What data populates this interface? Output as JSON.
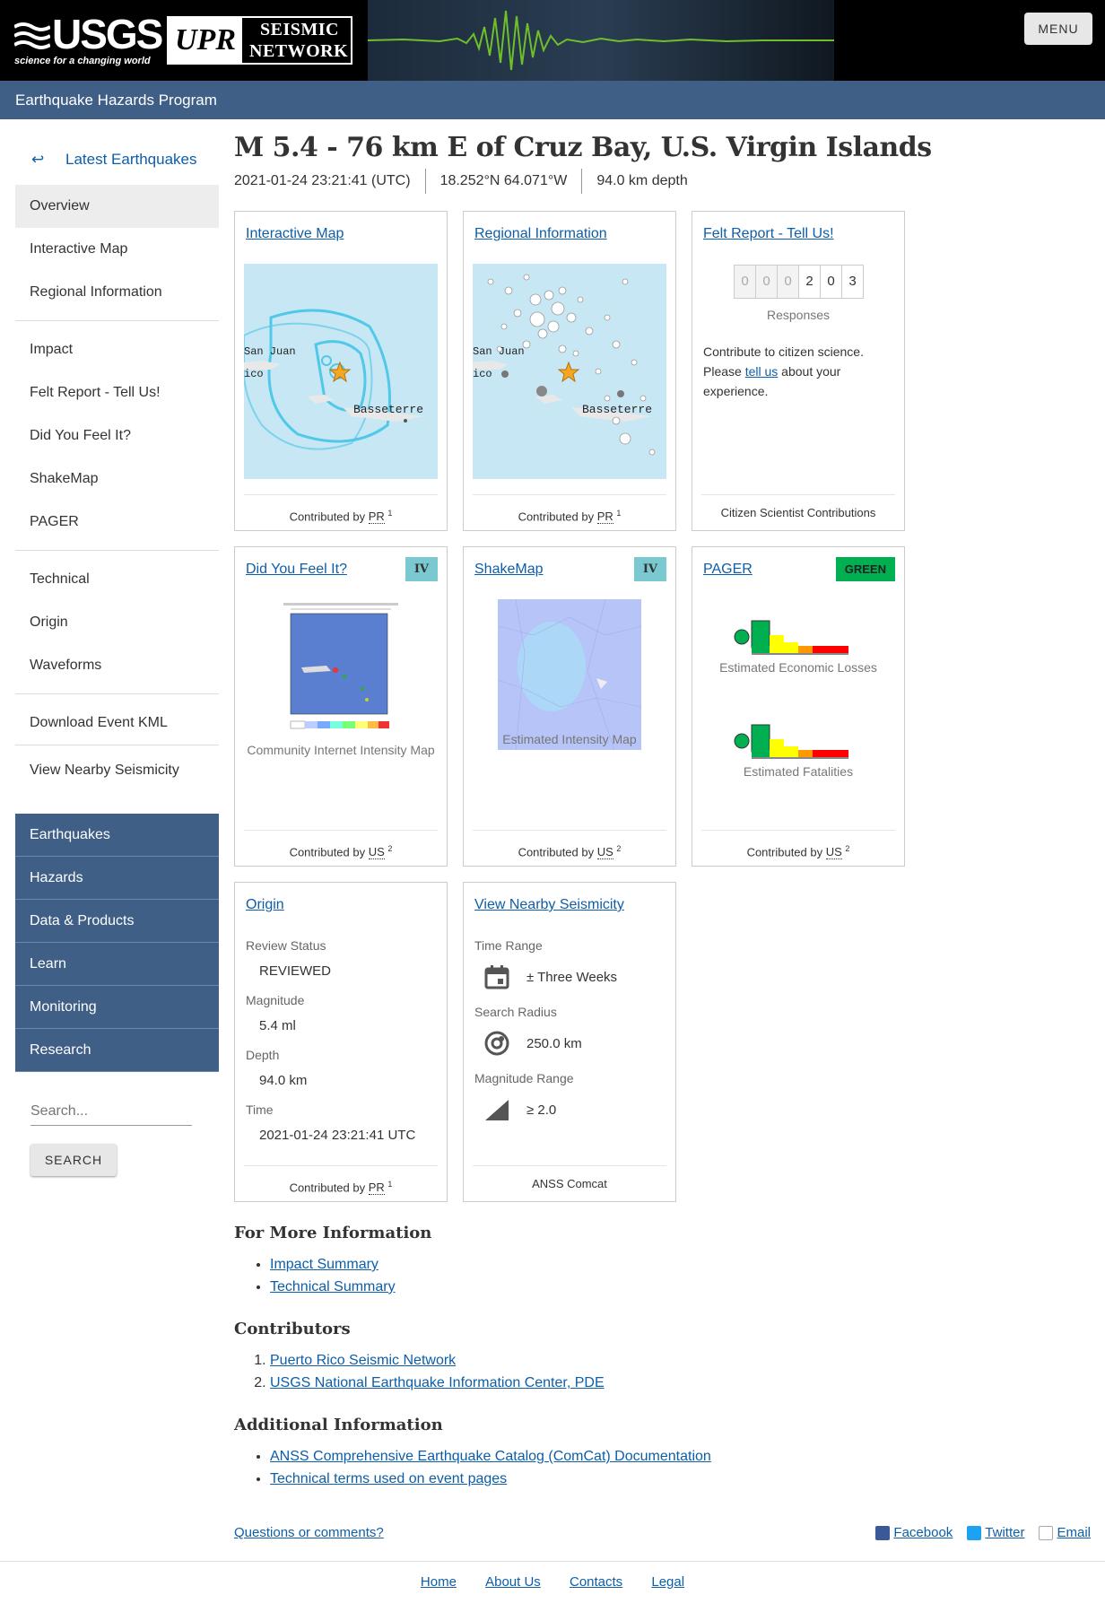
{
  "header": {
    "usgs_word": "USGS",
    "usgs_tagline": "science for a changing world",
    "upr_box": "UPR",
    "upr_line1": "SEISMIC",
    "upr_line2": "NETWORK",
    "menu_label": "MENU",
    "program": "Earthquake Hazards Program"
  },
  "sidebar": {
    "back_label": "Latest Earthquakes",
    "group1": [
      "Overview",
      "Interactive Map",
      "Regional Information"
    ],
    "group2": [
      "Impact",
      "Felt Report - Tell Us!",
      "Did You Feel It?",
      "ShakeMap",
      "PAGER"
    ],
    "group3": [
      "Technical",
      "Origin",
      "Waveforms"
    ],
    "group4": [
      "Download Event KML"
    ],
    "group5": [
      "View Nearby Seismicity"
    ],
    "dark_nav": [
      "Earthquakes",
      "Hazards",
      "Data & Products",
      "Learn",
      "Monitoring",
      "Research"
    ],
    "search_placeholder": "Search...",
    "search_button": "SEARCH"
  },
  "event": {
    "title": "M 5.4 - 76 km E of Cruz Bay, U.S. Virgin Islands",
    "time": "2021-01-24 23:21:41 (UTC)",
    "location": "18.252°N 64.071°W",
    "depth": "94.0 km depth"
  },
  "cards": {
    "interactive_map": {
      "title": "Interactive Map",
      "foot_prefix": "Contributed by ",
      "foot_src": "PR",
      "foot_sup": "1",
      "label_sanjuan": "San Juan",
      "label_basseterre": "Basseterre",
      "label_ico": "ico"
    },
    "regional": {
      "title": "Regional Information",
      "foot_prefix": "Contributed by ",
      "foot_src": "PR",
      "foot_sup": "1",
      "label_sanjuan": "San Juan",
      "label_basseterre": "Basseterre",
      "label_ico": "ico"
    },
    "felt": {
      "title": "Felt Report - Tell Us!",
      "digits": [
        "0",
        "0",
        "0",
        "2",
        "0",
        "3"
      ],
      "responses": "Responses",
      "text_before": "Contribute to citizen science. Please ",
      "link": "tell us",
      "text_after": " about your experience.",
      "foot": "Citizen Scientist Contributions"
    },
    "dyfi": {
      "title": "Did You Feel It?",
      "badge": "IV",
      "caption": "Community Internet Intensity Map",
      "foot_prefix": "Contributed by ",
      "foot_src": "US",
      "foot_sup": "2"
    },
    "shakemap": {
      "title": "ShakeMap",
      "badge": "IV",
      "caption": "Estimated Intensity Map",
      "foot_prefix": "Contributed by ",
      "foot_src": "US",
      "foot_sup": "2"
    },
    "pager": {
      "title": "PAGER",
      "badge": "GREEN",
      "caption_losses": "Estimated Economic Losses",
      "caption_fatalities": "Estimated Fatalities",
      "foot_prefix": "Contributed by ",
      "foot_src": "US",
      "foot_sup": "2"
    },
    "origin": {
      "title": "Origin",
      "review_label": "Review Status",
      "review_val": "REVIEWED",
      "mag_label": "Magnitude",
      "mag_val": "5.4 ml",
      "depth_label": "Depth",
      "depth_val": "94.0 km",
      "time_label": "Time",
      "time_val": "2021-01-24 23:21:41 UTC",
      "foot_prefix": "Contributed by ",
      "foot_src": "PR",
      "foot_sup": "1"
    },
    "nearby": {
      "title": "View Nearby Seismicity",
      "time_label": "Time Range",
      "time_val": "± Three Weeks",
      "radius_label": "Search Radius",
      "radius_val": "250.0 km",
      "mag_label": "Magnitude Range",
      "mag_val": "≥ 2.0",
      "foot": "ANSS Comcat"
    }
  },
  "more_info": {
    "heading": "For More Information",
    "links": [
      "Impact Summary",
      "Technical Summary"
    ]
  },
  "contributors": {
    "heading": "Contributors",
    "links": [
      "Puerto Rico Seismic Network",
      "USGS National Earthquake Information Center, PDE"
    ]
  },
  "additional": {
    "heading": "Additional Information",
    "links": [
      "ANSS Comprehensive Earthquake Catalog (ComCat) Documentation",
      "Technical terms used on event pages"
    ]
  },
  "footer": {
    "questions": "Questions or comments?",
    "facebook": "Facebook",
    "twitter": "Twitter",
    "email": "Email",
    "links": [
      "Home",
      "About Us",
      "Contacts",
      "Legal"
    ]
  },
  "colors": {
    "nav_blue": "#3f5f86",
    "link_blue": "#0d5ea8",
    "mmi_iv": "#7ac8d0",
    "pager_green": "#00b050"
  }
}
